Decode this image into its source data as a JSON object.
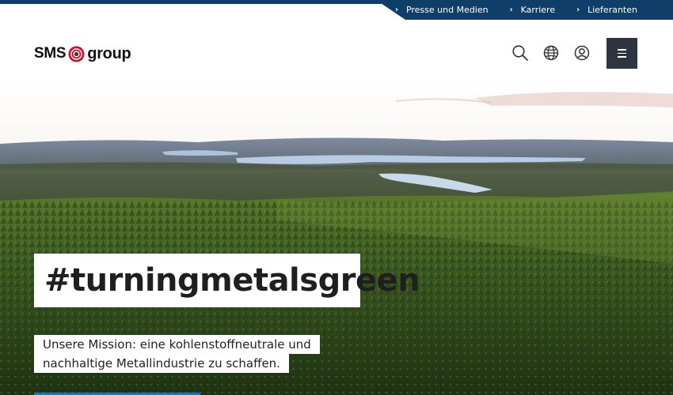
{
  "utility_nav": {
    "links": [
      {
        "label": "Presse und Medien"
      },
      {
        "label": "Karriere"
      },
      {
        "label": "Lieferanten"
      }
    ],
    "chevron": "›"
  },
  "header": {
    "logo": {
      "left": "SMS",
      "right": "group",
      "icon": "sms-logo-mark"
    },
    "icons": [
      "search-icon",
      "globe-icon",
      "user-icon",
      "menu-icon"
    ]
  },
  "hero": {
    "headline": "#turningmetalsgreen",
    "mission_lines": [
      "Unsere Mission: eine kohlenstoffneutrale und",
      "nachhaltige Metallindustrie zu schaffen."
    ]
  },
  "colors": {
    "navy": "#0f3f68",
    "menu_button": "#2e3440",
    "cta_blue": "#1d75b6",
    "logo_red": "#c8102e"
  }
}
